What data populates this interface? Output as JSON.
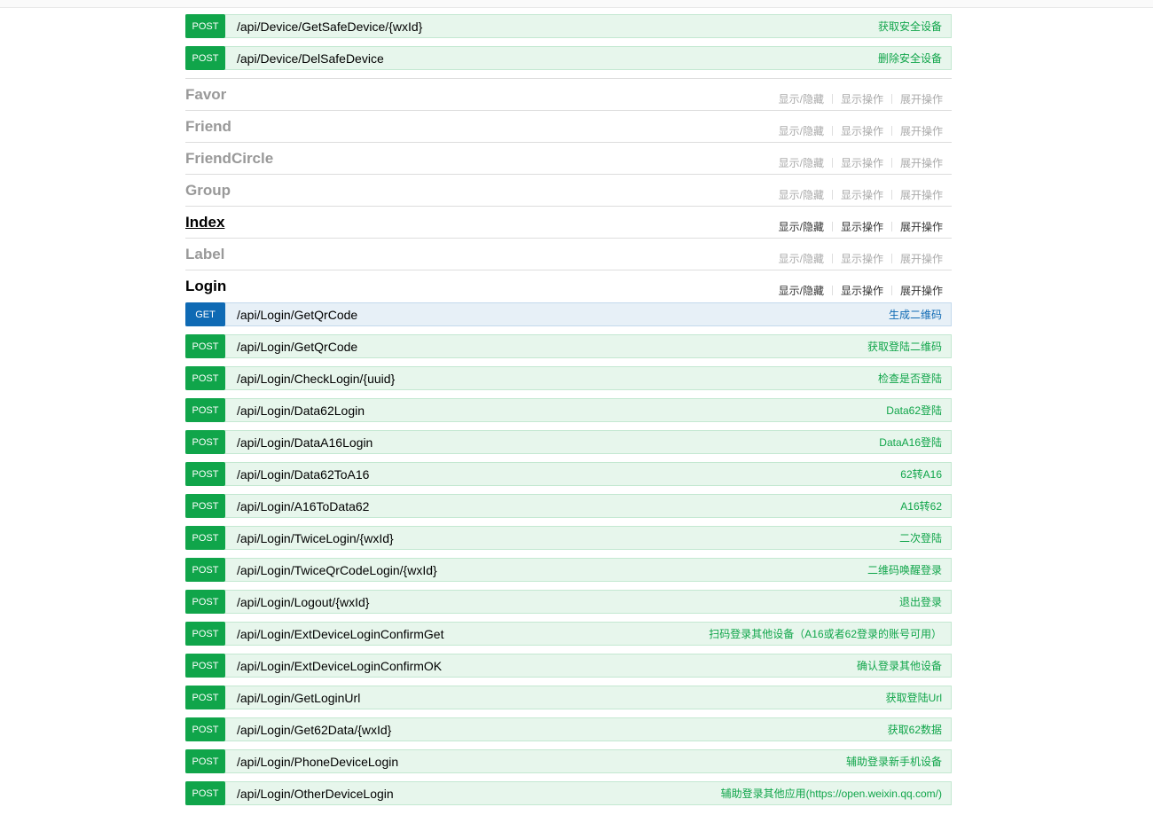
{
  "device_ops": [
    {
      "method": "POST",
      "path": "/api/Device/GetSafeDevice/{wxId}",
      "summary": "获取安全设备"
    },
    {
      "method": "POST",
      "path": "/api/Device/DelSafeDevice",
      "summary": "删除安全设备"
    }
  ],
  "actions": {
    "toggle": "显示/隐藏",
    "list": "显示操作",
    "expand": "展开操作"
  },
  "resources": [
    {
      "name": "Favor"
    },
    {
      "name": "Friend"
    },
    {
      "name": "FriendCircle"
    },
    {
      "name": "Group"
    },
    {
      "name": "Index"
    },
    {
      "name": "Label"
    },
    {
      "name": "Login"
    }
  ],
  "login_ops": [
    {
      "method": "GET",
      "path": "/api/Login/GetQrCode",
      "summary": "生成二维码"
    },
    {
      "method": "POST",
      "path": "/api/Login/GetQrCode",
      "summary": "获取登陆二维码"
    },
    {
      "method": "POST",
      "path": "/api/Login/CheckLogin/{uuid}",
      "summary": "检查是否登陆"
    },
    {
      "method": "POST",
      "path": "/api/Login/Data62Login",
      "summary": "Data62登陆"
    },
    {
      "method": "POST",
      "path": "/api/Login/DataA16Login",
      "summary": "DataA16登陆"
    },
    {
      "method": "POST",
      "path": "/api/Login/Data62ToA16",
      "summary": "62转A16"
    },
    {
      "method": "POST",
      "path": "/api/Login/A16ToData62",
      "summary": "A16转62"
    },
    {
      "method": "POST",
      "path": "/api/Login/TwiceLogin/{wxId}",
      "summary": "二次登陆"
    },
    {
      "method": "POST",
      "path": "/api/Login/TwiceQrCodeLogin/{wxId}",
      "summary": "二维码唤醒登录"
    },
    {
      "method": "POST",
      "path": "/api/Login/Logout/{wxId}",
      "summary": "退出登录"
    },
    {
      "method": "POST",
      "path": "/api/Login/ExtDeviceLoginConfirmGet",
      "summary": "扫码登录其他设备（A16或者62登录的账号可用）"
    },
    {
      "method": "POST",
      "path": "/api/Login/ExtDeviceLoginConfirmOK",
      "summary": "确认登录其他设备"
    },
    {
      "method": "POST",
      "path": "/api/Login/GetLoginUrl",
      "summary": "获取登陆Url"
    },
    {
      "method": "POST",
      "path": "/api/Login/Get62Data/{wxId}",
      "summary": "获取62数据"
    },
    {
      "method": "POST",
      "path": "/api/Login/PhoneDeviceLogin",
      "summary": "辅助登录新手机设备"
    },
    {
      "method": "POST",
      "path": "/api/Login/OtherDeviceLogin",
      "summary": "辅助登录其他应用(https://open.weixin.qq.com/)"
    }
  ]
}
